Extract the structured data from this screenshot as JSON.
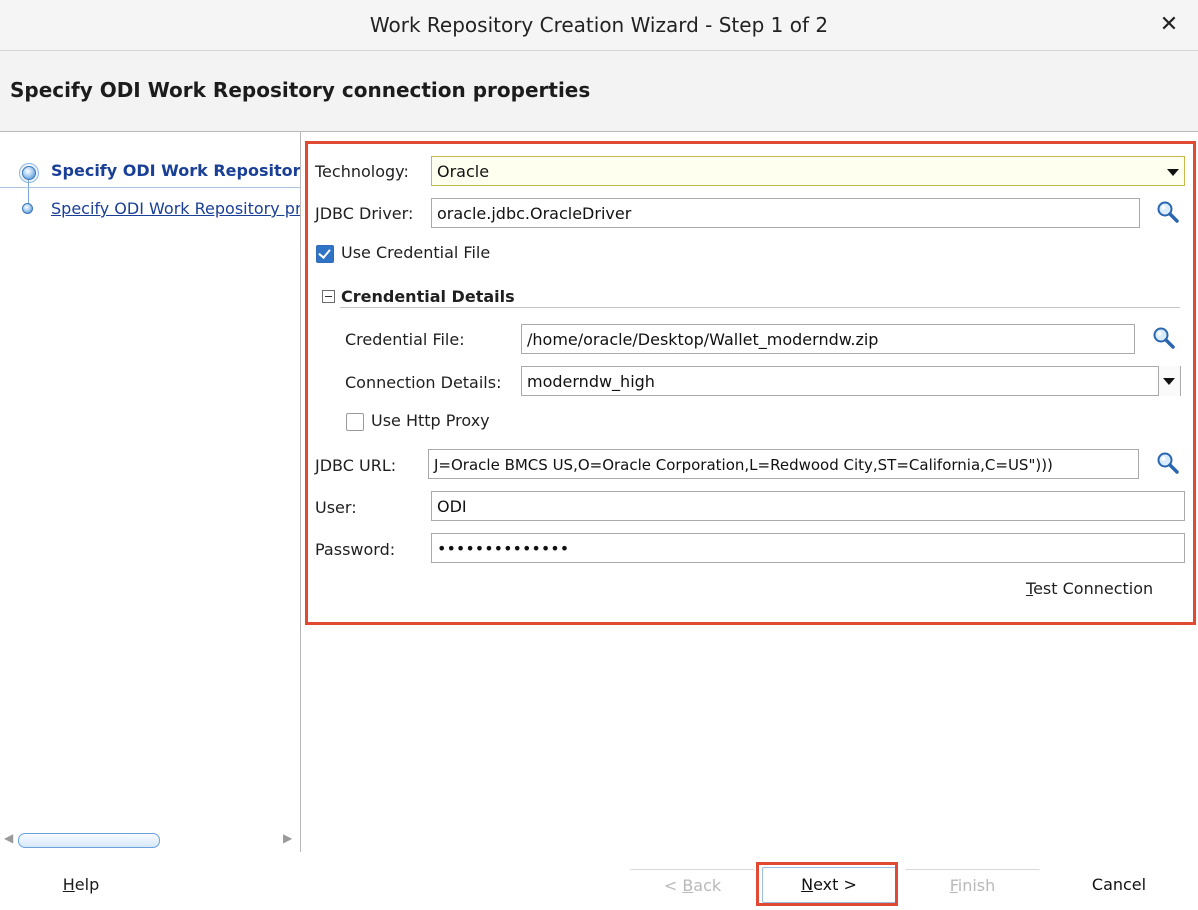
{
  "window": {
    "title": "Work Repository Creation Wizard - Step 1 of 2",
    "close_glyph": "✕"
  },
  "header": {
    "heading": "Specify ODI Work Repository connection properties"
  },
  "steps": {
    "items": [
      {
        "label": "Specify ODI Work Repository connection properties",
        "active": true
      },
      {
        "label": "Specify ODI Work Repository properties",
        "active": false
      }
    ]
  },
  "form": {
    "technology": {
      "label": "Technology:",
      "value": "Oracle"
    },
    "jdbc_driver": {
      "label": "JDBC Driver:",
      "value": "oracle.jdbc.OracleDriver"
    },
    "use_credential_file": {
      "label": "Use Credential File",
      "checked": true
    },
    "credential_section": {
      "title": "Crendential Details",
      "credential_file": {
        "label": "Credential File:",
        "value": "/home/oracle/Desktop/Wallet_moderndw.zip"
      },
      "connection_details": {
        "label": "Connection Details:",
        "value": "moderndw_high"
      },
      "use_http_proxy": {
        "label": "Use Http Proxy",
        "checked": false
      }
    },
    "jdbc_url": {
      "label": "JDBC URL:",
      "value": "J=Oracle BMCS US,O=Oracle Corporation,L=Redwood City,ST=California,C=US\")))"
    },
    "user": {
      "label": "User:",
      "value": "ODI"
    },
    "password": {
      "label": "Password:",
      "value": "••••••••••••••"
    },
    "test_connection": {
      "label_mnemonic": "T",
      "label_rest": "est Connection"
    }
  },
  "footer": {
    "help": {
      "mnemonic": "H",
      "rest": "elp"
    },
    "back": {
      "prefix": "< ",
      "mnemonic": "B",
      "rest": "ack"
    },
    "next": {
      "mnemonic": "N",
      "rest": "ext >"
    },
    "finish": {
      "mnemonic": "F",
      "rest": "inish"
    },
    "cancel": "Cancel"
  },
  "colors": {
    "highlight_red": "#e04a33",
    "link_blue": "#1a3f96",
    "checkbox_blue": "#2f73c7"
  },
  "icons": {
    "search": "search-icon",
    "close": "close-icon",
    "dropdown": "chevron-down-icon"
  }
}
